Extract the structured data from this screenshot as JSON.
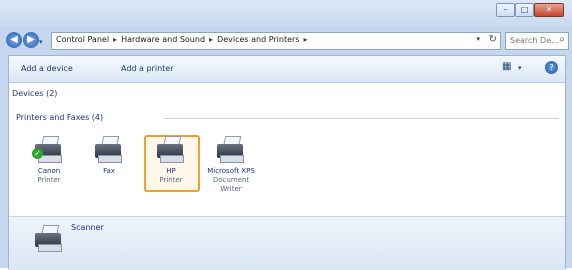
{
  "window": {
    "minimize_label": "–",
    "maximize_label": "□",
    "close_label": "✕"
  },
  "nav": {
    "back_icon": "back-arrow-icon",
    "forward_icon": "forward-arrow-icon",
    "back_glyph": "◀",
    "forward_glyph": "▶",
    "dropdown_glyph": "▾"
  },
  "address": {
    "crumbs": [
      "Control Panel",
      "Hardware and Sound",
      "Devices and Printers"
    ],
    "separator": "▸",
    "dropdown_glyph": "▾",
    "refresh_glyph": "↻"
  },
  "search": {
    "placeholder": "Search De...",
    "icon_glyph": "⌕"
  },
  "commands": {
    "add_device": "Add a device",
    "add_printer": "Add a printer",
    "view_glyph": "▦",
    "view_drop": "▾",
    "help_glyph": "?"
  },
  "devices": {
    "title": "Devices (2)"
  },
  "printers": {
    "title": "Printers and Faxes (4)",
    "items": [
      {
        "name": "Canon",
        "sub": "Printer",
        "default": true
      },
      {
        "name": "Fax",
        "sub": "",
        "default": false
      },
      {
        "name": "HP",
        "sub": "Printer",
        "default": false
      },
      {
        "name": "Microsoft XPS",
        "sub": "Document Writer",
        "default": false
      }
    ]
  },
  "unspecified": {
    "label": "Scanner"
  },
  "colors": {
    "selection_border": "#f0a030",
    "default_check": "#2fa52f",
    "link_text": "#1e3287"
  }
}
